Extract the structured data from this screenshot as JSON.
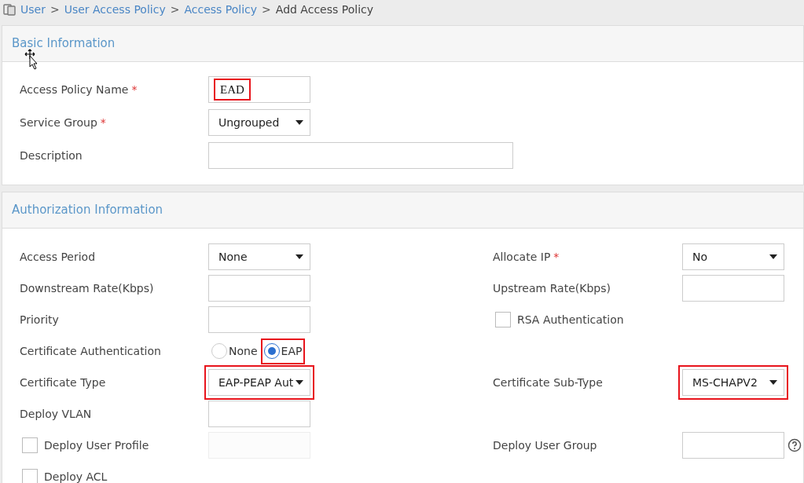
{
  "breadcrumb": [
    {
      "label": "User",
      "current": false
    },
    {
      "label": "User Access Policy",
      "current": false
    },
    {
      "label": "Access Policy",
      "current": false
    },
    {
      "label": "Add Access Policy",
      "current": true
    }
  ],
  "separator": ">",
  "sections": [
    {
      "title": "Basic Information",
      "rows": [
        {
          "left": {
            "kind": "text",
            "label": "Access Policy Name",
            "required_mark": "*",
            "value": "EAD",
            "highlighted": true
          }
        },
        {
          "left": {
            "kind": "select",
            "label": "Service Group",
            "required_mark": "*",
            "value": "Ungrouped"
          }
        },
        {
          "left": {
            "kind": "long_text",
            "label": "Description"
          }
        }
      ]
    },
    {
      "title": "Authorization Information",
      "rows": [
        {
          "left": {
            "kind": "select",
            "label": "Access Period",
            "value": "None"
          },
          "right": {
            "kind": "select",
            "label": "Allocate IP",
            "required_mark": "*",
            "value": "No"
          }
        },
        {
          "left": {
            "kind": "text",
            "label": "Downstream Rate(Kbps)"
          },
          "right": {
            "kind": "text",
            "label": "Upstream Rate(Kbps)"
          }
        },
        {
          "left": {
            "kind": "text",
            "label": "Priority"
          },
          "right": {
            "kind": "checkbox",
            "label": "RSA Authentication",
            "checked": false
          }
        },
        {
          "left": {
            "kind": "radio",
            "label": "Certificate Authentication",
            "options": [
              {
                "label": "None",
                "selected": false
              },
              {
                "label": "EAP",
                "selected": true,
                "highlighted": true
              }
            ]
          }
        },
        {
          "left": {
            "kind": "select",
            "label": "Certificate Type",
            "value": "EAP-PEAP Aut",
            "highlighted": true
          },
          "right": {
            "kind": "select",
            "label": "Certificate Sub-Type",
            "value": "MS-CHAPV2",
            "highlighted": true
          }
        },
        {
          "left": {
            "kind": "text",
            "label": "Deploy VLAN"
          }
        },
        {
          "left": {
            "kind": "checkfield",
            "label": "Deploy User Profile",
            "checked": false
          },
          "right": {
            "kind": "text",
            "label": "Deploy User Group",
            "help": true
          }
        },
        {
          "left": {
            "kind": "checkbox",
            "label": "Deploy ACL",
            "checked": false
          }
        }
      ]
    }
  ]
}
